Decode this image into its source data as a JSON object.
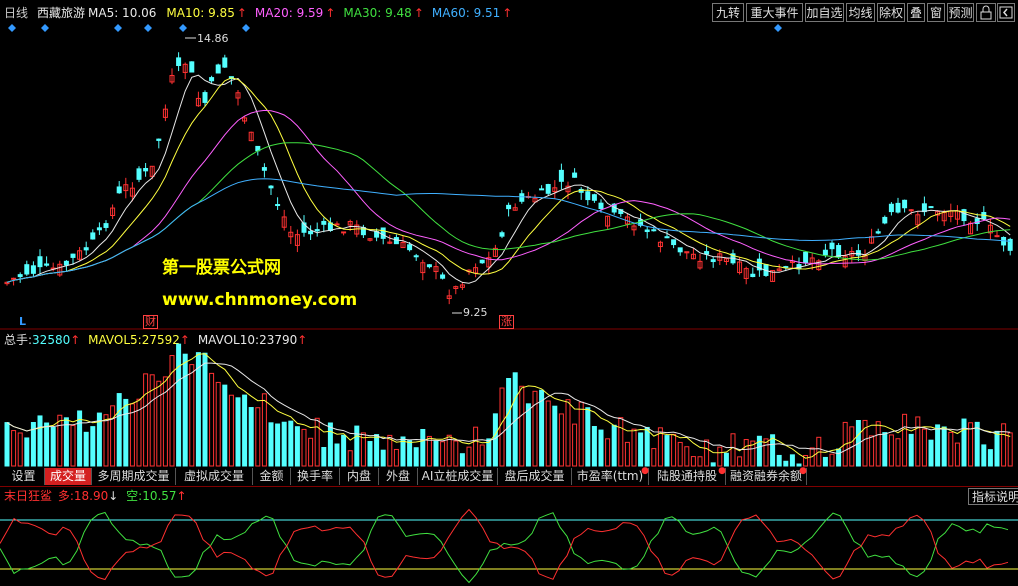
{
  "header": {
    "period": "日线",
    "stock_name": "西藏旅游",
    "ma": [
      {
        "label": "MA5: 10.06",
        "color": "#e8e8e8"
      },
      {
        "label": "MA10: 9.85",
        "color": "#ffff40"
      },
      {
        "label": "MA20: 9.59",
        "color": "#ff60ff"
      },
      {
        "label": "MA30: 9.48",
        "color": "#40e040"
      },
      {
        "label": "MA60: 9.51",
        "color": "#40b0ff"
      }
    ],
    "arrow_up": "↑",
    "arrow_down": "↓"
  },
  "toolbar": [
    "九转",
    "重大事件",
    "加自选",
    "均线",
    "除权",
    "叠",
    "窗",
    "预测"
  ],
  "toolbar_icons": [
    "lock-icon",
    "sidebar-toggle-icon"
  ],
  "price_labels": {
    "high": "14.86",
    "low": "9.25"
  },
  "markers": {
    "cai": "财",
    "zhang": "涨",
    "left_L": "L"
  },
  "watermark": {
    "line1": "第一股票公式网",
    "line2": "www.chnmoney.com"
  },
  "volume": {
    "total_label": "总手:",
    "total_value": "32580",
    "mavol5_label": "MAVOL5:",
    "mavol5_value": "27592",
    "mavol10_label": "MAVOL10:",
    "mavol10_value": "23790"
  },
  "tabs": [
    {
      "label": "设置",
      "active": false,
      "dot": false
    },
    {
      "label": "成交量",
      "active": true,
      "dot": false
    },
    {
      "label": "多周期成交量",
      "active": false,
      "dot": false
    },
    {
      "label": "虚拟成交量",
      "active": false,
      "dot": false
    },
    {
      "label": "金额",
      "active": false,
      "dot": false
    },
    {
      "label": "换手率",
      "active": false,
      "dot": false
    },
    {
      "label": "内盘",
      "active": false,
      "dot": false
    },
    {
      "label": "外盘",
      "active": false,
      "dot": false
    },
    {
      "label": "AI立桩成交量",
      "active": false,
      "dot": false
    },
    {
      "label": "盘后成交量",
      "active": false,
      "dot": false
    },
    {
      "label": "市盈率(ttm)",
      "active": false,
      "dot": true
    },
    {
      "label": "陆股通持股",
      "active": false,
      "dot": true
    },
    {
      "label": "融资融券余额",
      "active": false,
      "dot": true
    }
  ],
  "indicator": {
    "name": "末日狂鲨",
    "duo_label": "多:",
    "duo_value": "18.90",
    "kong_label": "空:",
    "kong_value": "10.57",
    "help": "指标说明"
  },
  "colors": {
    "up": "#ff3232",
    "down": "#54ffff",
    "ma5": "#e8e8e8",
    "ma10": "#ffff40",
    "ma20": "#ff60ff",
    "ma30": "#40e040",
    "ma60": "#40b0ff",
    "diamond": "#3399ff"
  }
}
